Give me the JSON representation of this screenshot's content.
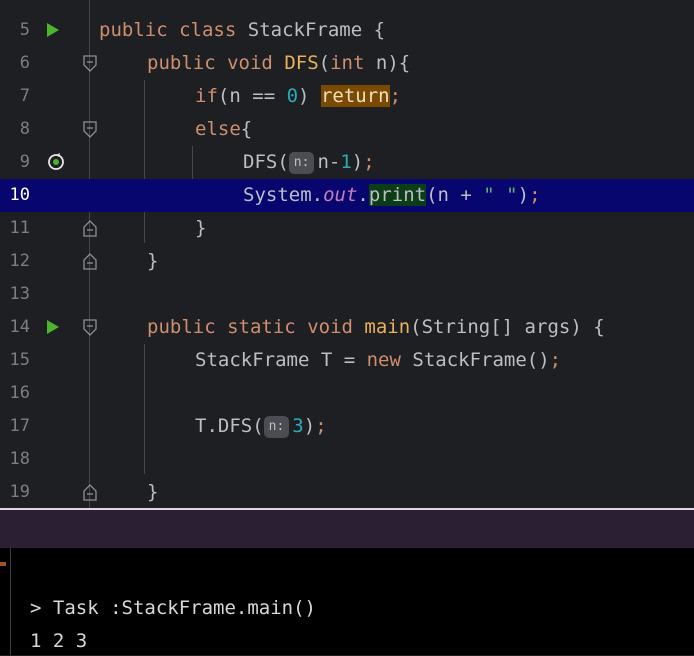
{
  "editor": {
    "lines": [
      {
        "num": "5"
      },
      {
        "num": "6"
      },
      {
        "num": "7"
      },
      {
        "num": "8"
      },
      {
        "num": "9"
      },
      {
        "num": "10"
      },
      {
        "num": "11"
      },
      {
        "num": "12"
      },
      {
        "num": "13"
      },
      {
        "num": "14"
      },
      {
        "num": "15"
      },
      {
        "num": "16"
      },
      {
        "num": "17"
      },
      {
        "num": "18"
      },
      {
        "num": "19"
      }
    ],
    "tokens": {
      "kw_public": "public",
      "kw_class": "class",
      "class_name": "StackFrame",
      "brace_open": "{",
      "brace_close": "}",
      "kw_void": "void",
      "dfs": "DFS",
      "paren_open": "(",
      "paren_close": ")",
      "kw_int": "int",
      "param_n": "n",
      "kw_if": "if",
      "eq": "==",
      "zero": "0",
      "kw_return": "return",
      "semicolon": ";",
      "kw_else": "else",
      "hint_n": "n:",
      "n_minus": "n-",
      "one": "1",
      "system": "System",
      "dot": ".",
      "out": "out",
      "print": "print",
      "n_plus": "n + ",
      "space_str": "\" \"",
      "kw_static": "static",
      "main": "main",
      "main_params": "(String[] args)",
      "decl_type": "StackFrame T = ",
      "kw_new": "new",
      "ctor": "StackFrame()",
      "t_dfs": "T.DFS(",
      "three": "3"
    }
  },
  "console": {
    "task_line": "> Task :StackFrame.main()",
    "output_line": "1 2 3"
  },
  "colors": {
    "background": "#1e1f22",
    "keyword": "#cf8e6d",
    "function": "#e8b25a",
    "number": "#2aacb8",
    "string": "#6aab73",
    "current_line": "#06066e",
    "run_gutter": "#4cb52d"
  }
}
